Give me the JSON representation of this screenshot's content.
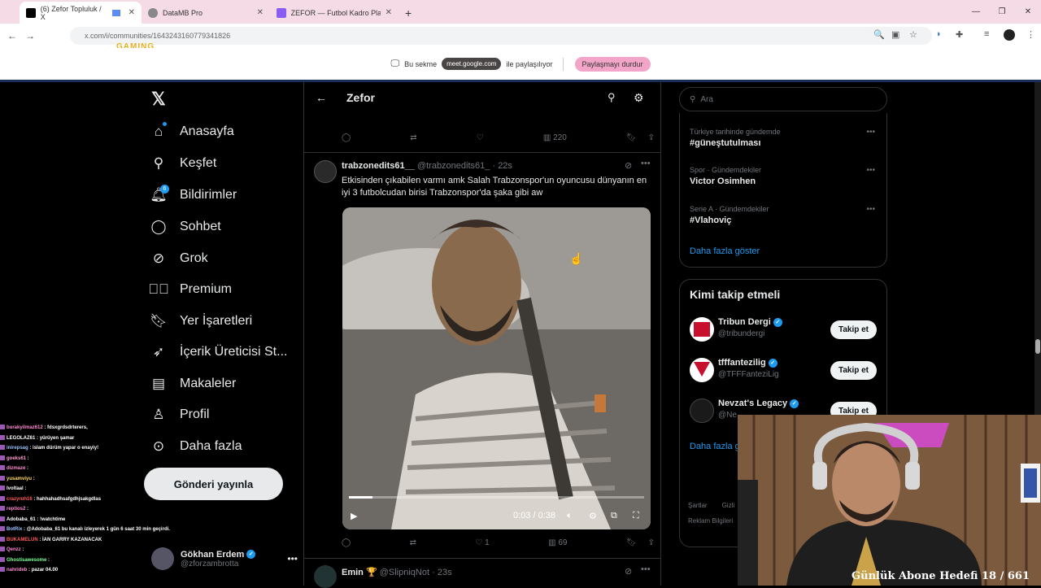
{
  "browser": {
    "tabs": [
      {
        "label": "(6) Zefor Topluluk / X",
        "active": true
      },
      {
        "label": "DataMB Pro",
        "active": false
      },
      {
        "label": "ZEFOR — Futbol Kadro Planlan",
        "active": false
      }
    ],
    "url": "x.com/i/communities/1643243160779341826",
    "overlay_logo": "GAMING"
  },
  "share_bar": {
    "prefix": "Bu sekme",
    "domain": "meet.google.com",
    "suffix": "ile paylaşılıyor",
    "stop": "Paylaşmayı durdur"
  },
  "nav": {
    "items": [
      {
        "label": "Anasayfa",
        "icon": "home-icon"
      },
      {
        "label": "Keşfet",
        "icon": "search-icon"
      },
      {
        "label": "Bildirimler",
        "icon": "bell-icon",
        "badge": "6"
      },
      {
        "label": "Sohbet",
        "icon": "chat-icon"
      },
      {
        "label": "Grok",
        "icon": "grok-icon"
      },
      {
        "label": "Premium",
        "icon": "premium-icon"
      },
      {
        "label": "Yer İşaretleri",
        "icon": "bookmark-icon"
      },
      {
        "label": "İçerik Üreticisi St...",
        "icon": "rocket-icon"
      },
      {
        "label": "Makaleler",
        "icon": "article-icon"
      },
      {
        "label": "Profil",
        "icon": "profile-icon"
      },
      {
        "label": "Daha fazla",
        "icon": "more-icon"
      }
    ],
    "post_button": "Gönderi yayınla",
    "account_name": "Gökhan Erdem",
    "account_handle": "@zforzambrotta"
  },
  "column": {
    "title": "Zefor",
    "prev_tweet_views": "220",
    "tweet": {
      "author": "trabzonedits61__",
      "handle": "@trabzonedits61_",
      "time": "22s",
      "text": "Etkisinden çıkabilen varmı amk Salah Trabzonspor'un oyuncusu dünyanın en iyi 3 futbolcudan birisi Trabzonspor'da şaka gibi aw",
      "video_time": "0:03 / 0:38",
      "video_progress": 0.08,
      "likes": "1",
      "views": "69"
    },
    "next_tweet": {
      "author": "Emin 🏆",
      "handle": "@SlipniqNot",
      "time": "23s"
    }
  },
  "right": {
    "search_placeholder": "Ara",
    "trends": [
      {
        "category": "Türkiye tarihinde gündemde",
        "name": "#güneştutulması"
      },
      {
        "category": "Spor · Gündemdekiler",
        "name": "Victor Osimhen"
      },
      {
        "category": "Serie A · Gündemdekiler",
        "name": "#Vlahoviç"
      }
    ],
    "show_more": "Daha fazla göster",
    "who_to_follow_title": "Kimi takip etmeli",
    "who_to_follow": [
      {
        "name": "Tribun Dergi",
        "handle": "@tribundergi",
        "button": "Takip et"
      },
      {
        "name": "tfffantezilig",
        "handle": "@TFFFanteziLig",
        "button": "Takip et"
      },
      {
        "name": "Nevzat's Legacy",
        "handle": "@Ne",
        "button": "Takip et"
      }
    ],
    "follow_more": "Daha fazla g",
    "footer": [
      "Şartlar",
      "Gizli",
      "Reklam Bilgileri"
    ]
  },
  "chat": [
    {
      "user": "burakyilmaz612",
      "msg": "fdsxgrdsdrterers,",
      "color": "#ff8ad0"
    },
    {
      "user": "LEGOLAZ61",
      "msg": "yürüyen şamar",
      "color": "#ffffff"
    },
    {
      "user": "inirepsag",
      "msg": "islam dürüm yapar o enayiy!",
      "color": "#9bc3ff"
    },
    {
      "user": "goeks61",
      "msg": "",
      "color": "#ff9acd"
    },
    {
      "user": "dizmaze",
      "msg": "",
      "color": "#ff8ad0"
    },
    {
      "user": "yusamviyu",
      "msg": "",
      "color": "#ffd966"
    },
    {
      "user": "lvoltaal",
      "msg": "",
      "color": "#ffffff"
    },
    {
      "user": "crazyruh16",
      "msg": "hahhahadhsafgdhjsakgdlas",
      "color": "#ff5c5c"
    },
    {
      "user": "reptios2",
      "msg": "",
      "color": "#ff8ad0"
    },
    {
      "user": "Adobaba_61",
      "msg": "!watchtime",
      "color": "#ffffff"
    },
    {
      "user": "BotRix",
      "msg": "@Adobaba_61 bu kanalı izleyerek 1 gün 6 saat 30 min geçirdi.",
      "color": "#9bc3ff"
    },
    {
      "user": "BUKAMELUN",
      "msg": "İAN GARRY KAZANACAK",
      "color": "#ff5c5c"
    },
    {
      "user": "Qenzz",
      "msg": "",
      "color": "#ff8ad0"
    },
    {
      "user": "Ghostisawesome",
      "msg": "",
      "color": "#7dff9a"
    },
    {
      "user": "nahrideb",
      "msg": "pazar 04.00",
      "color": "#ff8ad0"
    }
  ],
  "webcam": {
    "caption": "Günlük Abone Hedefi 18 / 661"
  }
}
